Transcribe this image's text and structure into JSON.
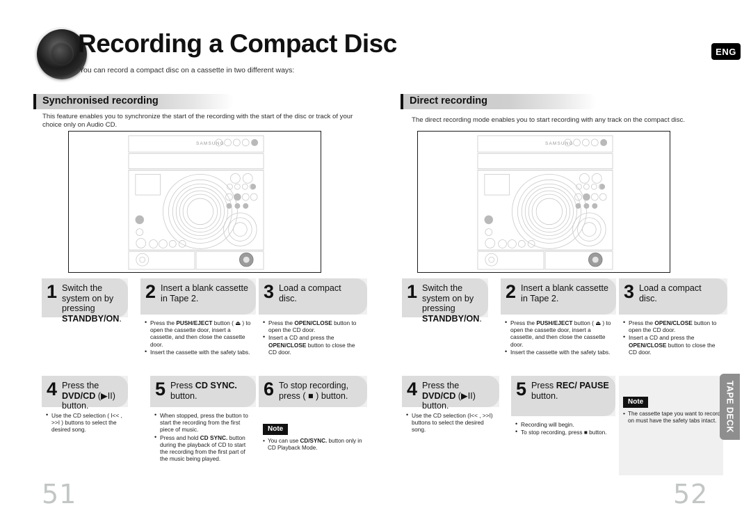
{
  "header": {
    "title": "Recording a Compact Disc",
    "subtitle": "You can record a compact disc on a cassette in two different ways:",
    "lang_badge": "ENG",
    "disc_icon": "speaker-disc-graphic"
  },
  "left_section": {
    "heading": "Synchronised recording",
    "description": "This feature enables you to synchronize the start of the recording with the start of the disc or track of your choice only on Audio CD.",
    "product_image": "samsung-stereo-system-line-art",
    "steps": [
      {
        "number": "1",
        "text_parts": [
          {
            "t": "Switch the system on by pressing ",
            "b": false
          },
          {
            "t": "STANDBY/ON",
            "b": true
          },
          {
            "t": ".",
            "b": false
          }
        ],
        "bullets": []
      },
      {
        "number": "2",
        "text_parts": [
          {
            "t": "Insert a blank cassette in Tape 2.",
            "b": false
          }
        ],
        "bullets": [
          [
            {
              "t": "Press the ",
              "b": false
            },
            {
              "t": "PUSH/EJECT",
              "b": true
            },
            {
              "t": " button ( ⏏ ) to open the cassette door, insert a cassette, and then close the cassette door.",
              "b": false
            }
          ],
          [
            {
              "t": "Insert the cassette with the safety tabs.",
              "b": false
            }
          ]
        ]
      },
      {
        "number": "3",
        "text_parts": [
          {
            "t": "Load a compact disc.",
            "b": false
          }
        ],
        "bullets": [
          [
            {
              "t": "Press the ",
              "b": false
            },
            {
              "t": "OPEN/CLOSE",
              "b": true
            },
            {
              "t": " button to open the CD door.",
              "b": false
            }
          ],
          [
            {
              "t": "Insert a CD and press the ",
              "b": false
            },
            {
              "t": "OPEN/CLOSE",
              "b": true
            },
            {
              "t": " button to close the CD door.",
              "b": false
            }
          ]
        ]
      },
      {
        "number": "4",
        "text_parts": [
          {
            "t": "Press the ",
            "b": false
          },
          {
            "t": "DVD/CD",
            "b": true
          },
          {
            "t": " (▶II) button.",
            "b": false
          }
        ],
        "bullets": [
          [
            {
              "t": "Use the CD selection ( I<< , >>I ) buttons to select the desired song.",
              "b": false
            }
          ]
        ]
      },
      {
        "number": "5",
        "text_parts": [
          {
            "t": "Press ",
            "b": false
          },
          {
            "t": "CD SYNC.",
            "b": true
          },
          {
            "t": " button.",
            "b": false
          }
        ],
        "bullets": [
          [
            {
              "t": "When stopped, press the button to start the recording from the first piece of music.",
              "b": false
            }
          ],
          [
            {
              "t": "Press and hold ",
              "b": false
            },
            {
              "t": "CD SYNC.",
              "b": true
            },
            {
              "t": " button during the playback of CD to start the recording from the first part of the music being played.",
              "b": false
            }
          ]
        ]
      },
      {
        "number": "6",
        "text_parts": [
          {
            "t": "To stop recording, press ( ■ ) button.",
            "b": false
          }
        ],
        "bullets": []
      }
    ],
    "note": {
      "badge": "Note",
      "items": [
        [
          {
            "t": "You can use ",
            "b": false
          },
          {
            "t": "CD/SYNC.",
            "b": true
          },
          {
            "t": " button only in CD Playback Mode.",
            "b": false
          }
        ]
      ]
    },
    "page_number": "51"
  },
  "right_section": {
    "heading": "Direct recording",
    "description": "The direct recording mode enables you to start recording with any track on the compact disc.",
    "product_image": "samsung-stereo-system-line-art",
    "steps": [
      {
        "number": "1",
        "text_parts": [
          {
            "t": "Switch the system on by pressing ",
            "b": false
          },
          {
            "t": "STANDBY/ON",
            "b": true
          },
          {
            "t": ".",
            "b": false
          }
        ],
        "bullets": []
      },
      {
        "number": "2",
        "text_parts": [
          {
            "t": "Insert a blank cassette in Tape 2.",
            "b": false
          }
        ],
        "bullets": [
          [
            {
              "t": "Press the ",
              "b": false
            },
            {
              "t": "PUSH/EJECT",
              "b": true
            },
            {
              "t": " button ( ⏏ ) to open the cassette door, insert a cassette, and then close the cassette door.",
              "b": false
            }
          ],
          [
            {
              "t": "Insert the cassette with the safety tabs.",
              "b": false
            }
          ]
        ]
      },
      {
        "number": "3",
        "text_parts": [
          {
            "t": "Load a compact disc.",
            "b": false
          }
        ],
        "bullets": [
          [
            {
              "t": "Press the ",
              "b": false
            },
            {
              "t": "OPEN/CLOSE",
              "b": true
            },
            {
              "t": " button to open the CD door.",
              "b": false
            }
          ],
          [
            {
              "t": "Insert a CD and press the ",
              "b": false
            },
            {
              "t": "OPEN/CLOSE",
              "b": true
            },
            {
              "t": " button to close the CD door.",
              "b": false
            }
          ]
        ]
      },
      {
        "number": "4",
        "text_parts": [
          {
            "t": "Press the ",
            "b": false
          },
          {
            "t": "DVD/CD",
            "b": true
          },
          {
            "t": " (▶II) button.",
            "b": false
          }
        ],
        "bullets": [
          [
            {
              "t": "Use the CD selection (I<< , >>I) buttons to select the desired song.",
              "b": false
            }
          ]
        ]
      },
      {
        "number": "5",
        "text_parts": [
          {
            "t": "Press ",
            "b": false
          },
          {
            "t": "REC/ PAUSE",
            "b": true
          },
          {
            "t": " button.",
            "b": false
          }
        ],
        "bullets": [
          [
            {
              "t": "Recording will begin.",
              "b": false
            }
          ],
          [
            {
              "t": "To stop recording, press ■ button.",
              "b": false
            }
          ]
        ]
      }
    ],
    "note": {
      "badge": "Note",
      "items": [
        [
          {
            "t": "The cassette tape you want to record on must have the safety tabs intact.",
            "b": false
          }
        ]
      ]
    },
    "page_number": "52"
  },
  "side_tab": {
    "label": "TAPE DECK"
  },
  "colors": {
    "step_head_gray": "#dcdcdc",
    "section_band_gray": "#c9c9c9",
    "tab_gray": "#8e8e8e",
    "page_number_gray": "#c2c6c4",
    "badge_black": "#000000"
  }
}
